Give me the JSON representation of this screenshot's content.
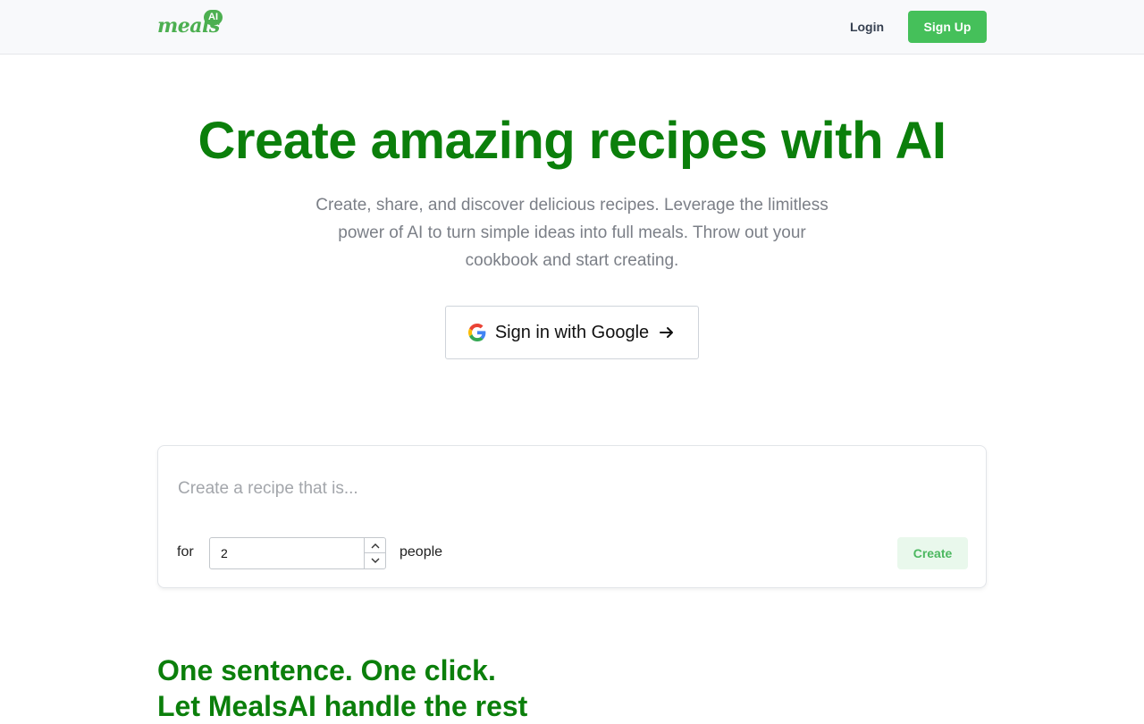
{
  "header": {
    "logo_text": "meals",
    "logo_badge": "AI",
    "login_label": "Login",
    "signup_label": "Sign Up"
  },
  "hero": {
    "title": "Create amazing recipes with AI",
    "subtitle": "Create, share, and discover delicious recipes. Leverage the limitless power of AI to turn simple ideas into full meals. Throw out your cookbook and start creating.",
    "google_button_label": "Sign in with Google"
  },
  "recipe_form": {
    "placeholder": "Create a recipe that is...",
    "for_label": "for",
    "people_count": "2",
    "people_label": "people",
    "create_label": "Create"
  },
  "section": {
    "line1": "One sentence. One click.",
    "line2": "Let MealsAI handle the rest"
  },
  "colors": {
    "brand_green": "#0b7f0b",
    "button_green": "#45c05a",
    "logo_green": "#4caf50"
  },
  "icons": [
    "google-icon",
    "arrow-right-icon",
    "chevron-up-icon",
    "chevron-down-icon"
  ]
}
